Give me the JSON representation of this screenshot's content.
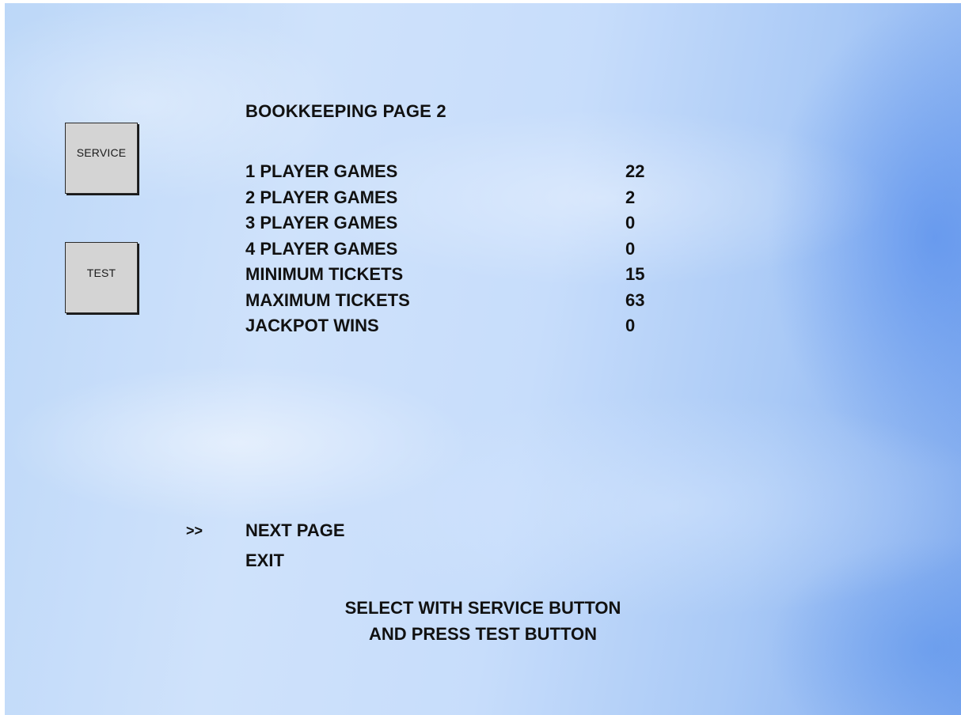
{
  "side_buttons": {
    "service_label": "SERVICE",
    "test_label": "TEST"
  },
  "page_title": "BOOKKEEPING PAGE 2",
  "stats": [
    {
      "label": "1 PLAYER GAMES",
      "value": "22"
    },
    {
      "label": "2 PLAYER GAMES",
      "value": "2"
    },
    {
      "label": "3 PLAYER GAMES",
      "value": "0"
    },
    {
      "label": "4 PLAYER GAMES",
      "value": "0"
    },
    {
      "label": "MINIMUM TICKETS",
      "value": "15"
    },
    {
      "label": "MAXIMUM TICKETS",
      "value": "63"
    },
    {
      "label": "JACKPOT WINS",
      "value": "0"
    }
  ],
  "menu": {
    "cursor": ">>",
    "items": [
      {
        "label": "NEXT PAGE",
        "selected": true
      },
      {
        "label": "EXIT",
        "selected": false
      }
    ]
  },
  "instructions": {
    "line1": "SELECT WITH SERVICE BUTTON",
    "line2": "AND PRESS TEST BUTTON"
  }
}
